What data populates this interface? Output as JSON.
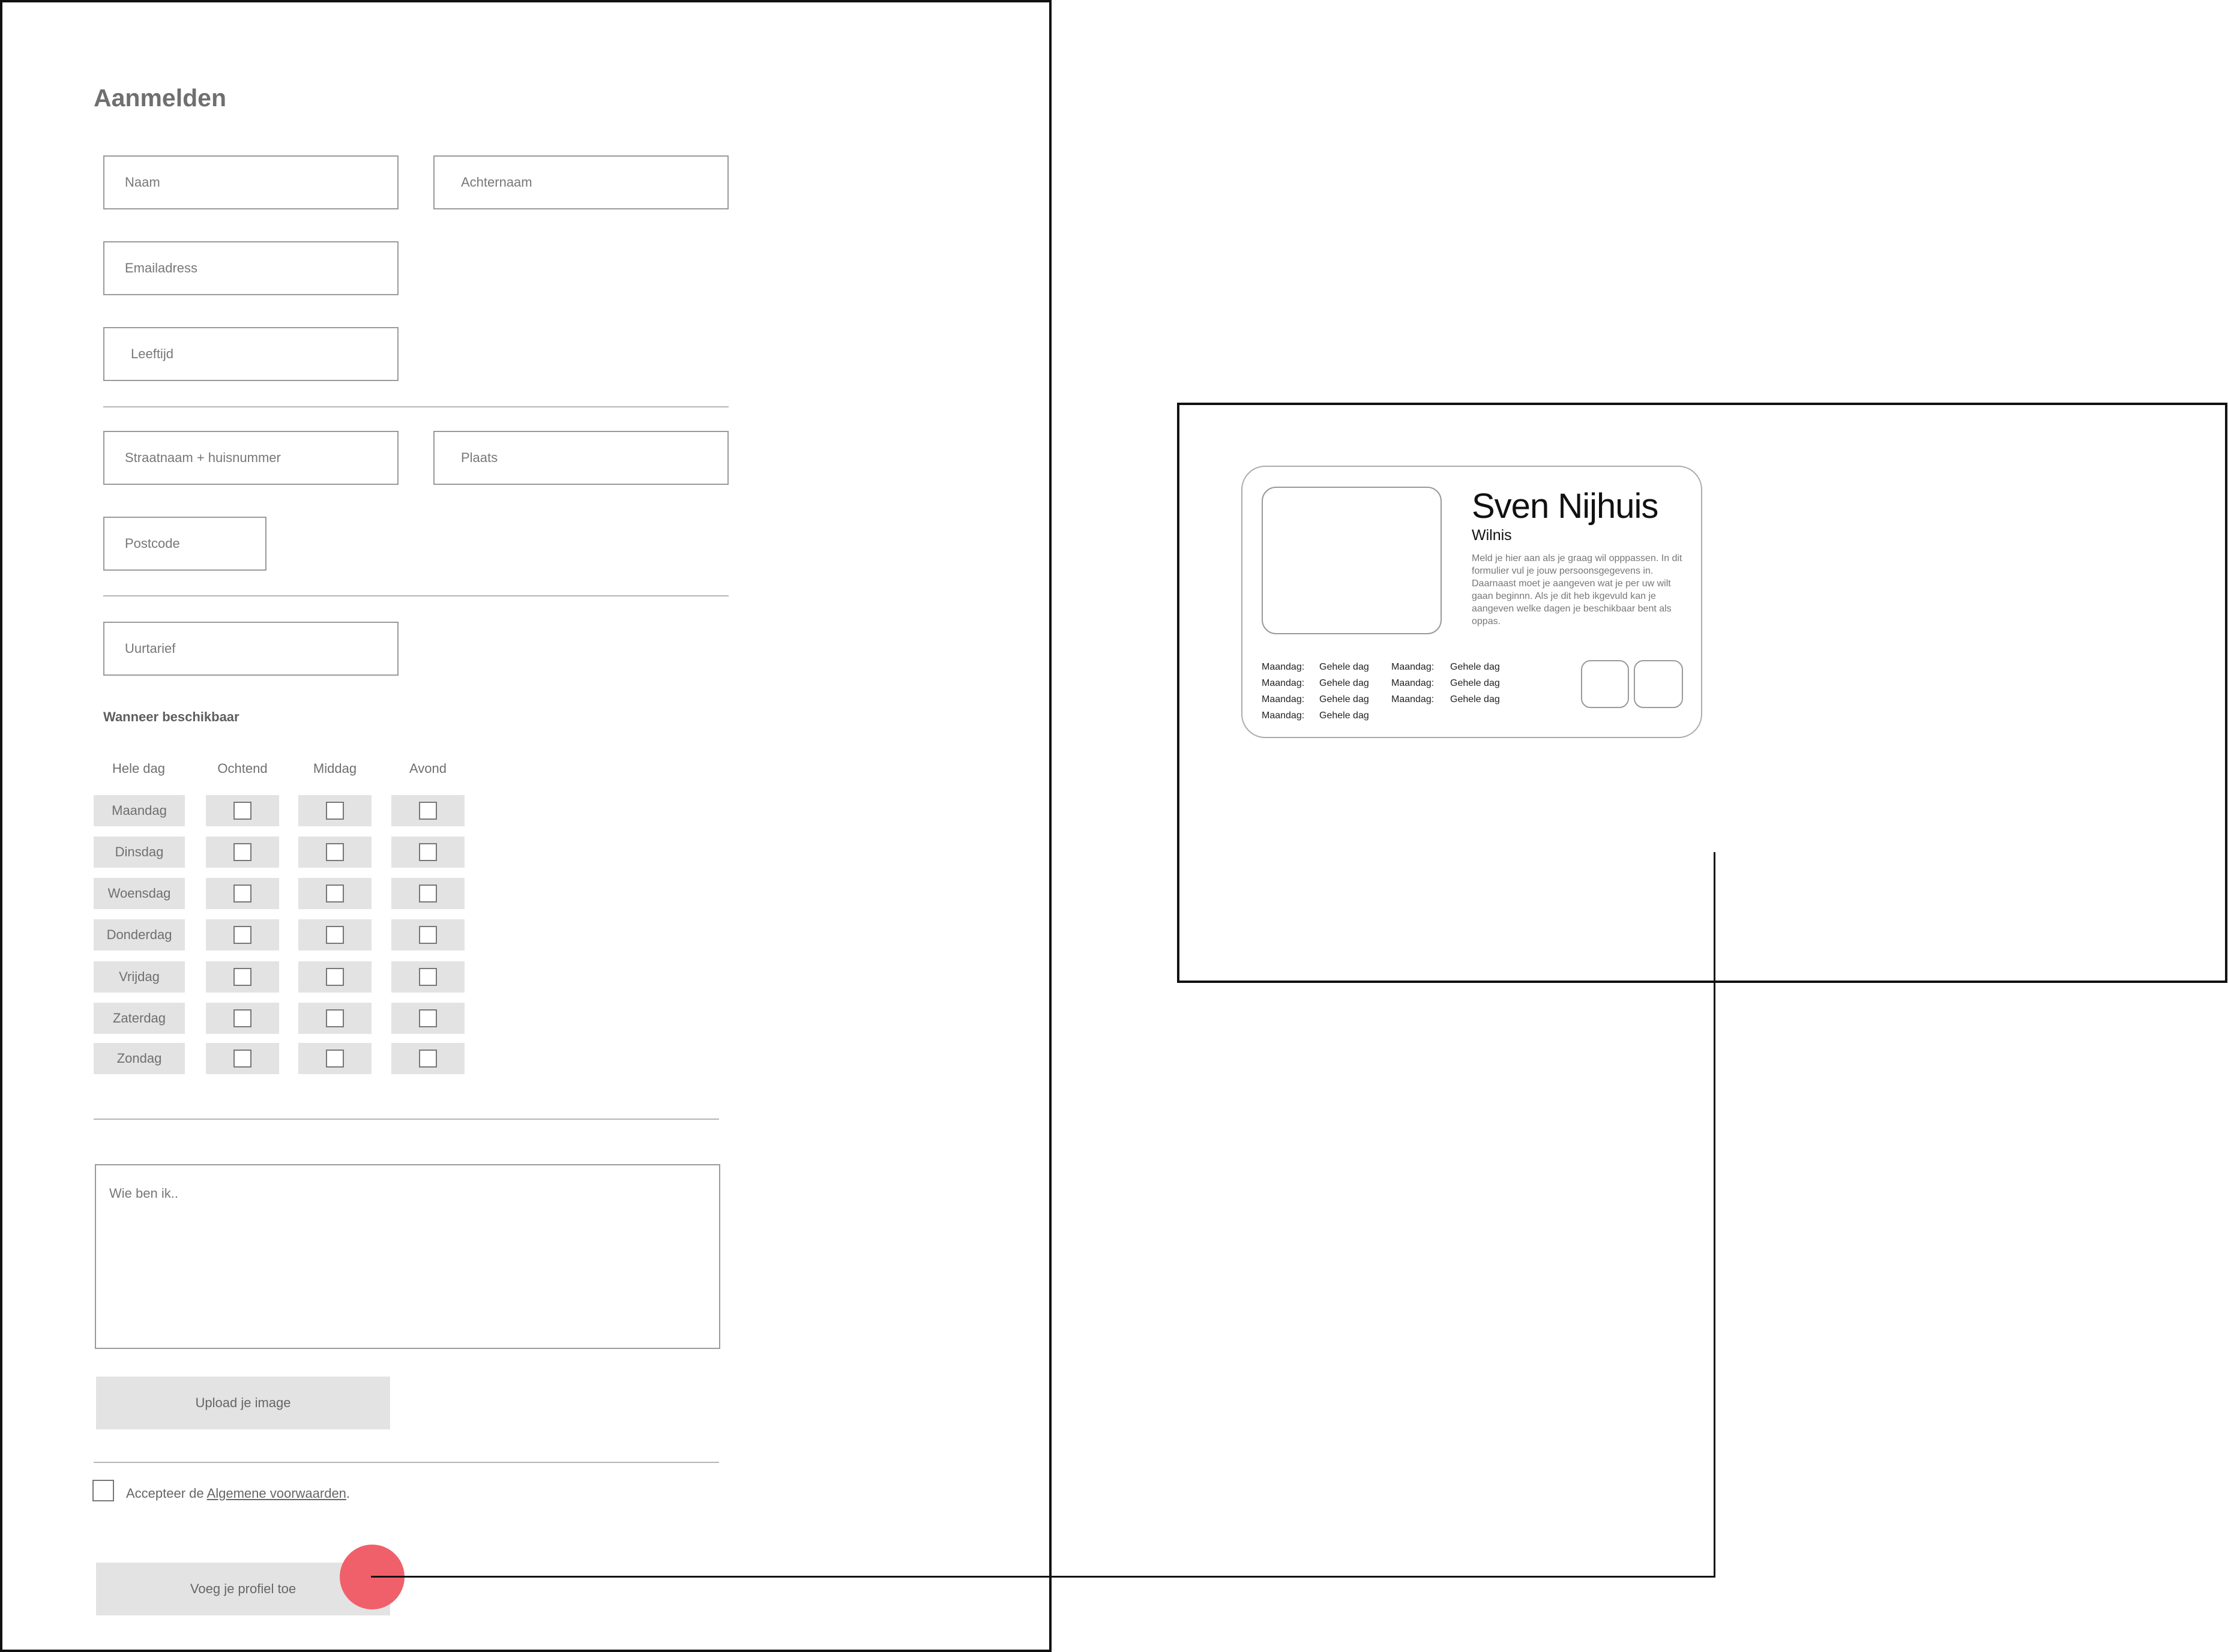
{
  "form": {
    "title": "Aanmelden",
    "fields": {
      "naam": "Naam",
      "achternaam": "Achternaam",
      "email": "Emailadress",
      "leeftijd": "Leeftijd",
      "straat": "Straatnaam + huisnummer",
      "plaats": "Plaats",
      "postcode": "Postcode",
      "uurtarief": "Uurtarief"
    },
    "availability_label": "Wanneer beschikbaar",
    "columns": [
      "Hele dag",
      "Ochtend",
      "Middag",
      "Avond"
    ],
    "days": [
      "Maandag",
      "Dinsdag",
      "Woensdag",
      "Donderdag",
      "Vrijdag",
      "Zaterdag",
      "Zondag"
    ],
    "about_placeholder": "Wie ben ik..",
    "upload_label": "Upload je image",
    "terms_prefix": "Accepteer de",
    "terms_link": "Algemene voorwaarden",
    "terms_suffix": ".",
    "submit_label": "Voeg je profiel toe"
  },
  "profile": {
    "name": "Sven Nijhuis",
    "city": "Wilnis",
    "description": "Meld je hier aan als je graag wil opppassen. In dit formulier vul je jouw persoonsgegevens in. Daarnaast moet je aangeven wat je per uw wilt gaan beginnn. Als je dit heb ikgevuld kan je aangeven welke dagen je beschikbaar bent als oppas.",
    "schedule_left": [
      {
        "day": "Maandag:",
        "time": "Gehele dag"
      },
      {
        "day": "Maandag:",
        "time": "Gehele dag"
      },
      {
        "day": "Maandag:",
        "time": "Gehele dag"
      },
      {
        "day": "Maandag:",
        "time": "Gehele dag"
      }
    ],
    "schedule_right": [
      {
        "day": "Maandag:",
        "time": "Gehele dag"
      },
      {
        "day": "Maandag:",
        "time": "Gehele dag"
      },
      {
        "day": "Maandag:",
        "time": "Gehele dag"
      }
    ]
  },
  "colors": {
    "frame": "#111111",
    "cell_fill": "#e3e3e3",
    "hotspot": "#f0606a"
  }
}
